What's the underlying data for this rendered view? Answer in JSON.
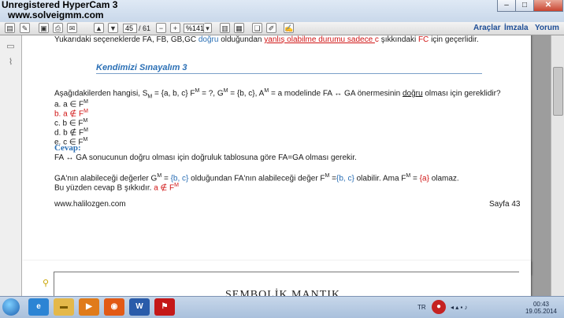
{
  "watermark": {
    "line1": "Unregistered HyperCam 3",
    "line2": "www.solveigmm.com"
  },
  "toolbar": {
    "page_current": "45",
    "page_total": "/ 61",
    "zoom": "%141",
    "links": [
      "Araçlar",
      "İmzala",
      "Yorum"
    ]
  },
  "document": {
    "top_line": {
      "p1": "Yukarıdaki seçeneklerde FA, FB, GB,GC ",
      "p2": "doğru",
      "p3": " olduğundan ",
      "p4": "yanlış olabilme durumu sadece ",
      "p5": "c",
      "p6": " şıkkındaki ",
      "p7": "FC",
      "p8": " için geçerlidir."
    },
    "heading": "Kendimizi Sınayalım 3",
    "question": {
      "p1": "Aşağıdakilerden hangisi, S",
      "p1sub": "M",
      "p2": " = {a, b, c} F",
      "p2sup": "M",
      "p3": " = ?, G",
      "p3sup": "M",
      "p4": " = {b, c}, A",
      "p4sup": "M",
      "p5": " = a modelinde FA ↔ GA önermesinin ",
      "p6": "doğru",
      "p7": " olması için gereklidir?"
    },
    "options": [
      {
        "text": "a. a ∈ F",
        "sup": "M",
        "color": "#1a1a1a"
      },
      {
        "text": "b. a ∉ F",
        "sup": "M",
        "color": "#d01515"
      },
      {
        "text": "c. b ∈ F",
        "sup": "M",
        "color": "#1a1a1a"
      },
      {
        "text": "d. b ∉ F",
        "sup": "M",
        "color": "#1a1a1a"
      },
      {
        "text": "e. c ∈ F",
        "sup": "M",
        "color": "#1a1a1a"
      }
    ],
    "answer_label": "Cevap:",
    "answer_line1": "FA ↔ GA sonucunun doğru olması için doğruluk tablosuna göre FA=GA olması gerekir.",
    "answer_line2": {
      "p1": "GA'nın alabileceği değerler G",
      "p1sup": "M",
      "p2": " = ",
      "p3": "{b, c}",
      "p4": " olduğundan FA'nın alabileceği değer F",
      "p4sup": "M",
      "p5": " =",
      "p6": "{b, c}",
      "p7": " olabilir. Ama F",
      "p7sup": "M",
      "p8": " = ",
      "p9": "{a}",
      "p10": " olamaz."
    },
    "answer_line3": {
      "p1": "Bu yüzden cevap B şıkkıdır. ",
      "p2": "a ∉ F",
      "p2sup": "M"
    },
    "footer_left": "www.halilozgen.com",
    "footer_right": "Sayfa 43",
    "next_page_title": "SEMBOLİK MANTIK"
  },
  "taskbar": {
    "lang": "TR",
    "time": "00:43",
    "date": "19.05.2014"
  },
  "colors": {
    "accent_blue": "#2a6fb5",
    "accent_red": "#d01515"
  }
}
